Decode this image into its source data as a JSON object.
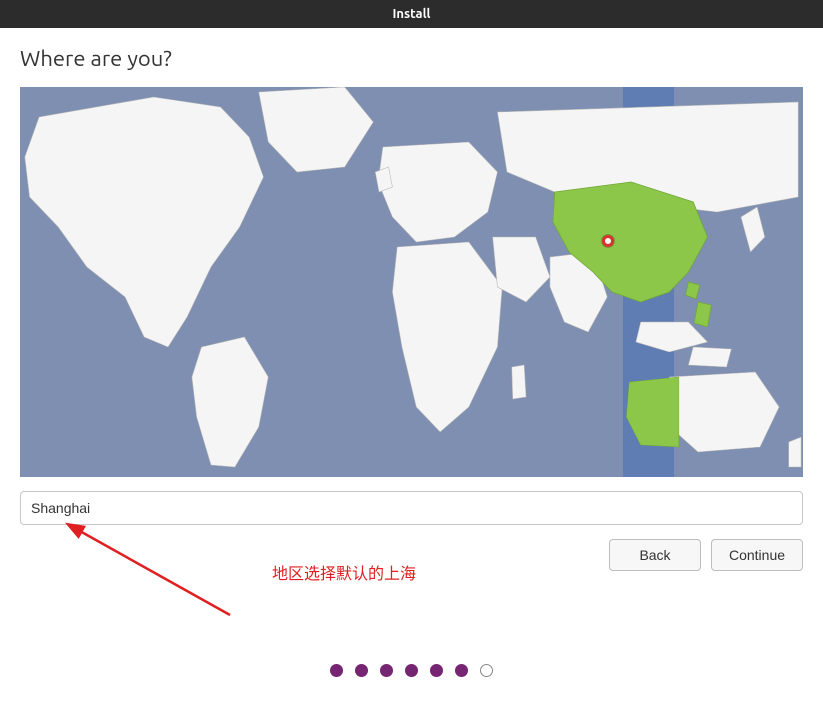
{
  "titlebar": {
    "title": "Install"
  },
  "heading": "Where are you?",
  "location_input": {
    "value": "Shanghai"
  },
  "buttons": {
    "back": "Back",
    "continue": "Continue"
  },
  "annotation": {
    "text": "地区选择默认的上海"
  },
  "progress": {
    "total": 7,
    "filled": 6
  },
  "map": {
    "highlighted_region": "China",
    "region_color": "#8cc74a",
    "marker_city": "Shanghai"
  }
}
